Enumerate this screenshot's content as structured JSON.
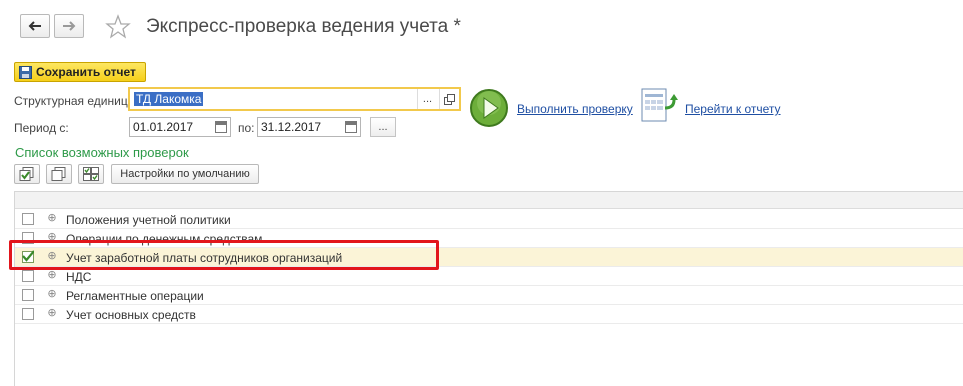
{
  "header": {
    "back_icon": "arrow-left-icon",
    "forward_icon": "arrow-right-icon",
    "favorite_icon": "star-icon",
    "title": "Экспресс-проверка ведения учета *"
  },
  "toolbar": {
    "save_label": "Сохранить отчет"
  },
  "form": {
    "org_label": "Структурная единица:",
    "org_value": "ТД Лакомка",
    "org_select_label": "...",
    "period_label": "Период с:",
    "date_from": "01.01.2017",
    "to_label": "по:",
    "date_to": "31.12.2017",
    "period_select_label": "..."
  },
  "actions": {
    "run_check_label": "Выполнить проверку",
    "go_to_report_label": "Перейти к отчету"
  },
  "checks": {
    "section_title": "Список возможных проверок",
    "defaults_button_label": "Настройки по умолчанию",
    "items": [
      {
        "label": "Положения учетной политики",
        "checked": false
      },
      {
        "label": "Операции по денежным средствам",
        "checked": false
      },
      {
        "label": "Учет заработной платы сотрудников организаций",
        "checked": true
      },
      {
        "label": "НДС",
        "checked": false
      },
      {
        "label": "Регламентные операции",
        "checked": false
      },
      {
        "label": "Учет основных средств",
        "checked": false
      }
    ]
  },
  "colors": {
    "accent_green": "#2e9a49",
    "save_yellow": "#f6cf1a",
    "highlight_red": "#e2151c",
    "selected_row": "#fbf4d7",
    "link_blue": "#1f4fa3"
  }
}
